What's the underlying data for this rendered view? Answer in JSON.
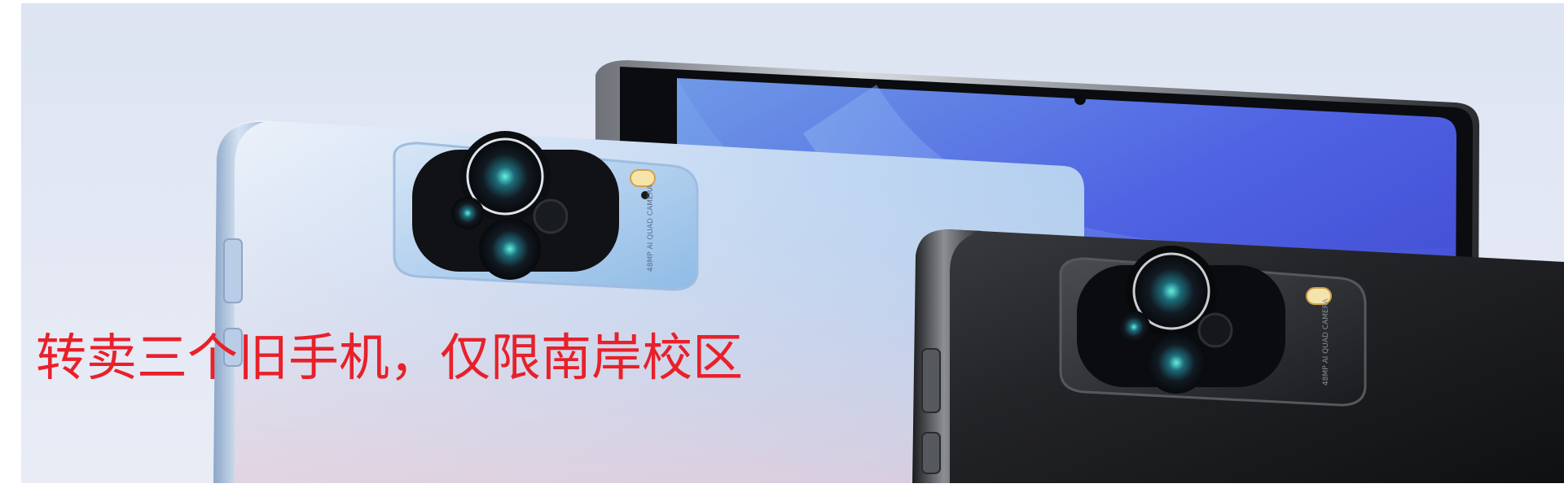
{
  "caption": "转卖三个旧手机，仅限南岸校区",
  "lens_text": "48MP AI QUAD CAMERA",
  "colors": {
    "background": "#dfe6f3",
    "caption": "#e8202a",
    "phone_blue_back": "#9cc3ec",
    "phone_black_back": "#1c1c1e",
    "phone_screen": "#4b64e0"
  },
  "objects": [
    "front-phone-screen",
    "blue-phone-back",
    "black-phone-back"
  ]
}
